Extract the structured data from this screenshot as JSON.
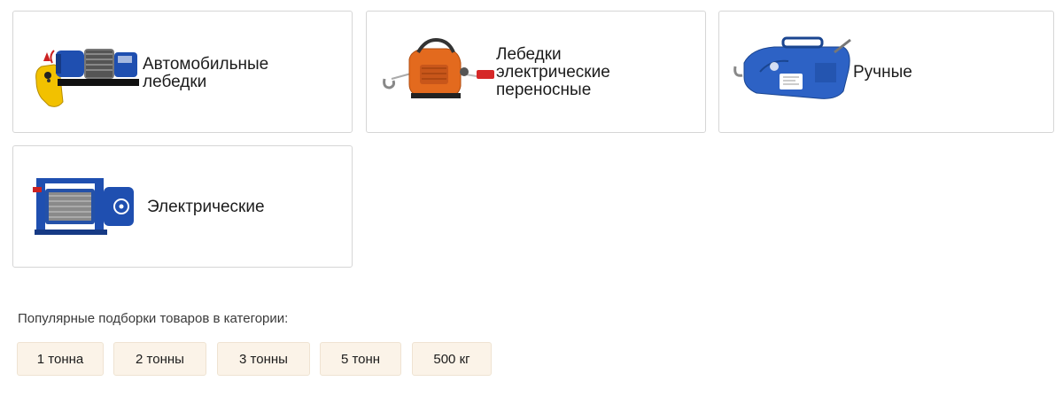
{
  "categories": [
    {
      "label": "Автомобильные\nлебедки",
      "icon": "car-winch-icon"
    },
    {
      "label": "Лебедки\nэлектрические\nпереносные",
      "icon": "portable-electric-winch-icon"
    },
    {
      "label": "Ручные",
      "icon": "manual-winch-icon"
    },
    {
      "label": "Электрические",
      "icon": "electric-winch-icon"
    }
  ],
  "popular": {
    "title": "Популярные подборки товаров в категории:",
    "chips": [
      "1 тонна",
      "2 тонны",
      "3 тонны",
      "5 тонн",
      "500 кг"
    ]
  },
  "colors": {
    "card_border": "#d6d6d6",
    "chip_bg": "#fbf3e8",
    "winch_blue": "#1e55b3",
    "winch_orange": "#e36a1e"
  }
}
